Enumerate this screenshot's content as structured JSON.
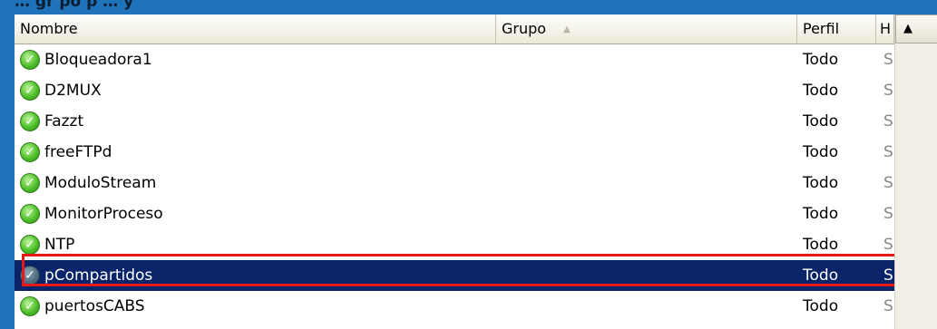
{
  "caption": "… gr po p …                  y",
  "columns": {
    "name": "Nombre",
    "group": "Grupo",
    "profile": "Perfil",
    "extra": "H"
  },
  "rows": [
    {
      "name": "Bloqueadora1",
      "perfil": "Todo",
      "extra": "S"
    },
    {
      "name": "D2MUX",
      "perfil": "Todo",
      "extra": "S"
    },
    {
      "name": "Fazzt",
      "perfil": "Todo",
      "extra": "S"
    },
    {
      "name": "freeFTPd",
      "perfil": "Todo",
      "extra": "S"
    },
    {
      "name": "ModuloStream",
      "perfil": "Todo",
      "extra": "S"
    },
    {
      "name": "MonitorProceso",
      "perfil": "Todo",
      "extra": "S"
    },
    {
      "name": "NTP",
      "perfil": "Todo",
      "extra": "S"
    },
    {
      "name": "pCompartidos",
      "perfil": "Todo",
      "extra": "S"
    },
    {
      "name": "puertosCABS",
      "perfil": "Todo",
      "extra": "S"
    }
  ],
  "colors": {
    "selection": "#0a246a",
    "highlight_box": "#e81818",
    "enabled_icon": "#4fbf2a"
  },
  "icons": {
    "row_status": "check-enabled-icon",
    "sort": "sort-ascending-icon",
    "scroll_up": "arrow-up-icon"
  }
}
